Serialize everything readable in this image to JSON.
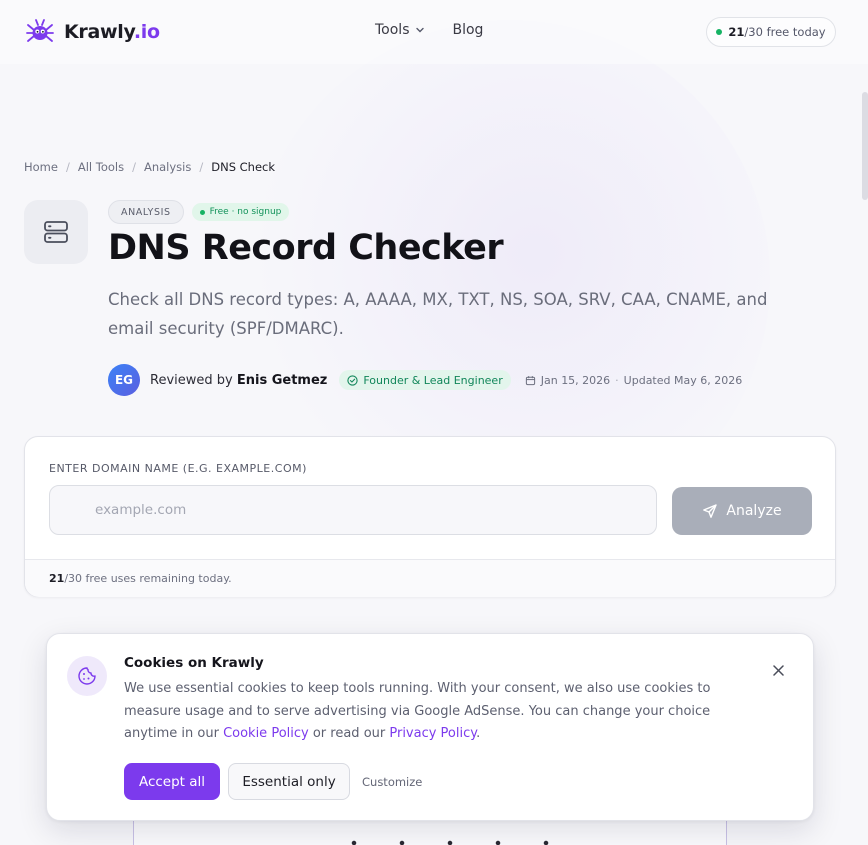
{
  "header": {
    "brand_name": "Krawly",
    "brand_tld": ".io",
    "nav": [
      {
        "label": "Tools",
        "has_dropdown": true
      },
      {
        "label": "Blog"
      }
    ],
    "quota_used": "21",
    "quota_rest": "/30 free today"
  },
  "breadcrumb": [
    "Home",
    "All Tools",
    "Analysis",
    "DNS Check"
  ],
  "hero": {
    "icon": "server-icon",
    "category_badge": "ANALYSIS",
    "free_badge": "Free · no signup",
    "title": "DNS Record Checker",
    "subtitle": "Check all DNS record types: A, AAAA, MX, TXT, NS, SOA, SRV, CAA, CNAME, and email security (SPF/DMARC)."
  },
  "reviewer": {
    "initials": "EG",
    "prefix": "Reviewed by",
    "name": "Enis Getmez",
    "role": "Founder & Lead Engineer",
    "published": "Jan 15, 2026",
    "separator": "·",
    "updated": "Updated May 6, 2026"
  },
  "form": {
    "label": "ENTER DOMAIN NAME (E.G. EXAMPLE.COM)",
    "placeholder": "example.com",
    "value": "",
    "submit_label": "Analyze",
    "remaining_count": "21",
    "remaining_rest": "/30 free uses remaining today."
  },
  "cookie_banner": {
    "title": "Cookies on Krawly",
    "text_before": "We use essential cookies to keep tools running. With your consent, we also use cookies to measure usage and to serve advertising via Google AdSense. You can change your choice anytime in our ",
    "cookie_policy_link": "Cookie Policy",
    "text_middle": " or read our ",
    "privacy_policy_link": "Privacy Policy",
    "text_end": ".",
    "accept_label": "Accept all",
    "essential_label": "Essential only",
    "customize_label": "Customize"
  },
  "colors": {
    "accent": "#7c3aed",
    "success": "#16b364",
    "disabled_button": "#a9aeb9"
  }
}
